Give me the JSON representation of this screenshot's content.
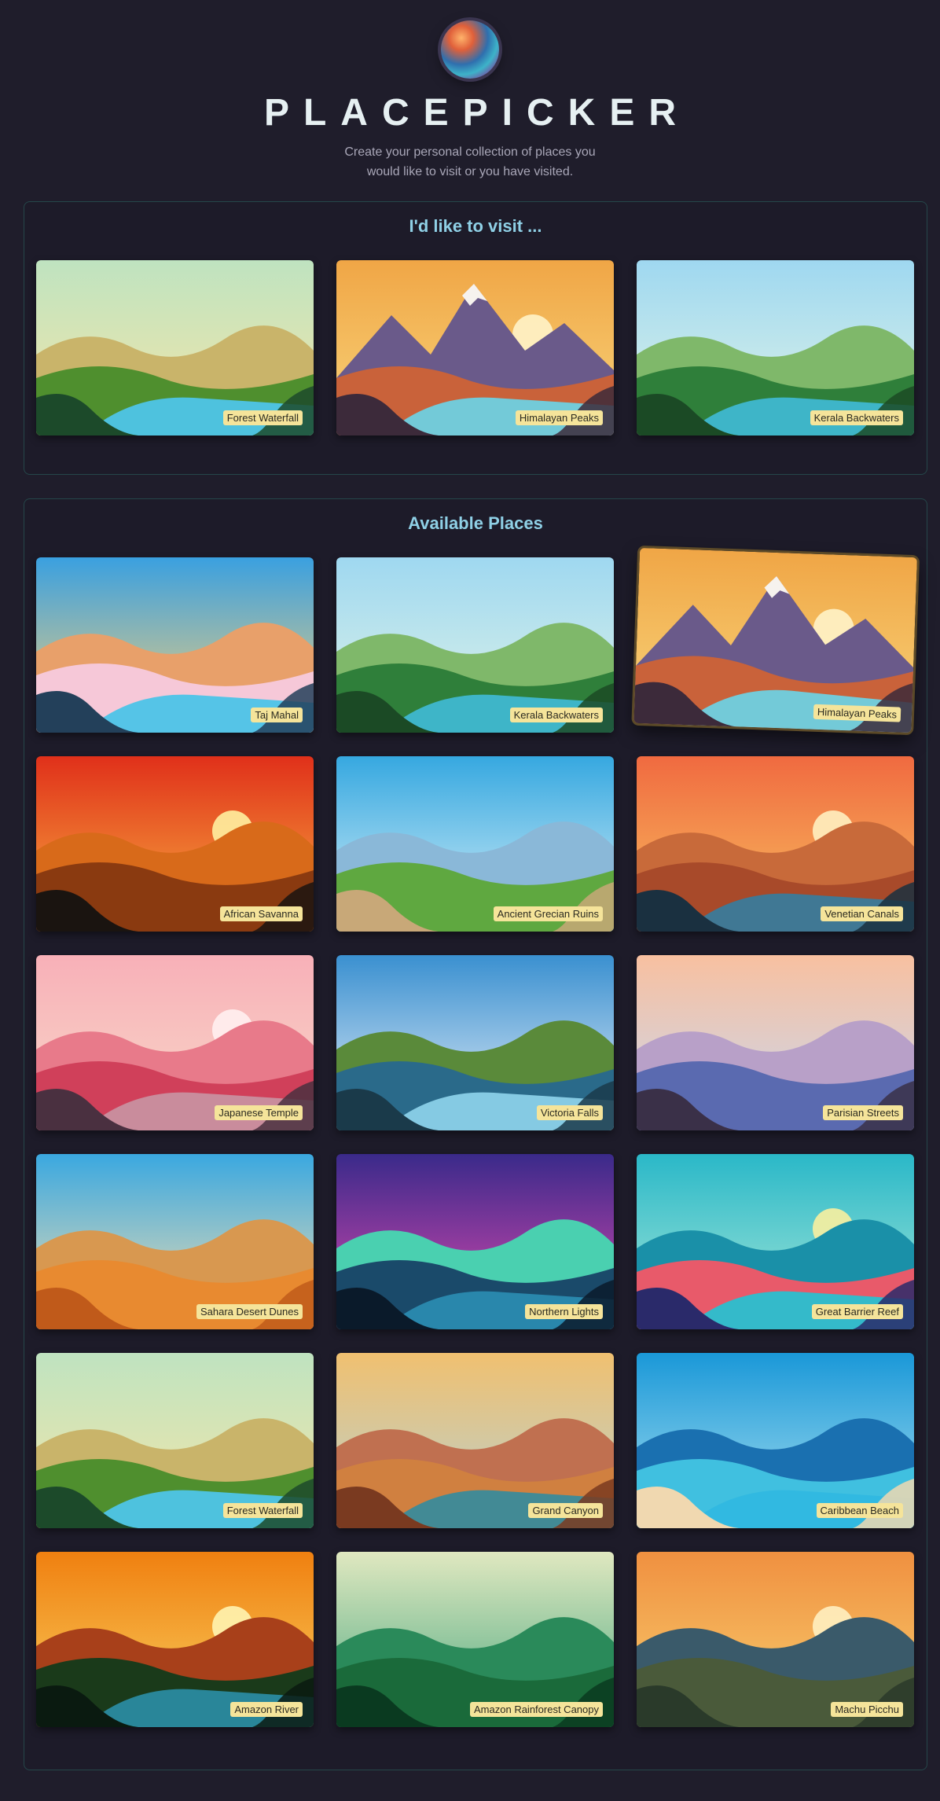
{
  "app": {
    "title": "PLACEPICKER",
    "description": "Create your personal collection of places you would like to visit or you have visited.",
    "logo_icon": "globe-icon"
  },
  "selected_section": {
    "title": "I'd like to visit ...",
    "places": [
      {
        "title": "Forest Waterfall",
        "theme": "waterfall"
      },
      {
        "title": "Himalayan Peaks",
        "theme": "mountains"
      },
      {
        "title": "Kerala Backwaters",
        "theme": "backwaters"
      }
    ]
  },
  "available_section": {
    "title": "Available Places",
    "places": [
      {
        "title": "Taj Mahal",
        "theme": "tajmahal"
      },
      {
        "title": "Kerala Backwaters",
        "theme": "backwaters"
      },
      {
        "title": "Himalayan Peaks",
        "theme": "mountains",
        "state": "hovered"
      },
      {
        "title": "African Savanna",
        "theme": "savanna"
      },
      {
        "title": "Ancient Grecian Ruins",
        "theme": "ruins"
      },
      {
        "title": "Venetian Canals",
        "theme": "venice"
      },
      {
        "title": "Japanese Temple",
        "theme": "temple"
      },
      {
        "title": "Victoria Falls",
        "theme": "falls"
      },
      {
        "title": "Parisian Streets",
        "theme": "paris"
      },
      {
        "title": "Sahara Desert Dunes",
        "theme": "desert"
      },
      {
        "title": "Northern Lights",
        "theme": "aurora"
      },
      {
        "title": "Great Barrier Reef",
        "theme": "reef"
      },
      {
        "title": "Forest Waterfall",
        "theme": "waterfall"
      },
      {
        "title": "Grand Canyon",
        "theme": "canyon"
      },
      {
        "title": "Caribbean Beach",
        "theme": "beach"
      },
      {
        "title": "Amazon River",
        "theme": "river"
      },
      {
        "title": "Amazon Rainforest Canopy",
        "theme": "rainforest"
      },
      {
        "title": "Machu Picchu",
        "theme": "machu"
      }
    ]
  },
  "colors": {
    "background": "#1f1d2b",
    "heading_accent": "#8fd0e6",
    "label_bg": "#f5e49a",
    "panel_border": "#25474a"
  }
}
